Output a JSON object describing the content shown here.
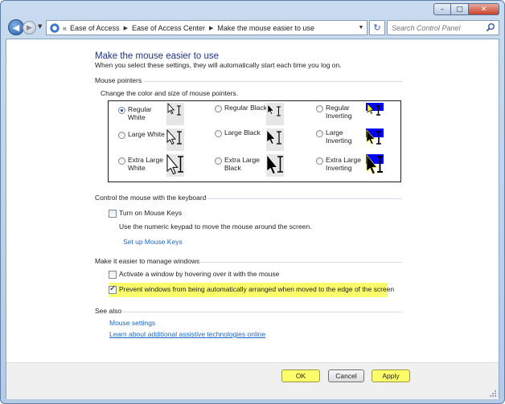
{
  "window": {
    "minimize_glyph": "–",
    "maximize_glyph": "□",
    "close_glyph": "✕"
  },
  "nav": {
    "back_glyph": "◀",
    "forward_glyph": "▶",
    "overflow": "«",
    "breadcrumbs": [
      "Ease of Access",
      "Ease of Access Center",
      "Make the mouse easier to use"
    ],
    "search_placeholder": "Search Control Panel"
  },
  "page": {
    "title": "Make the mouse easier to use",
    "subtitle": "When you select these settings, they will automatically start each time you log on."
  },
  "mouse_pointers": {
    "heading": "Mouse pointers",
    "instruction": "Change the color and size of mouse pointers.",
    "options": [
      {
        "label": "Regular White",
        "selected": true
      },
      {
        "label": "Regular Black",
        "selected": false
      },
      {
        "label": "Regular Inverting",
        "selected": false
      },
      {
        "label": "Large White",
        "selected": false
      },
      {
        "label": "Large Black",
        "selected": false
      },
      {
        "label": "Large Inverting",
        "selected": false
      },
      {
        "label": "Extra Large White",
        "selected": false
      },
      {
        "label": "Extra Large Black",
        "selected": false
      },
      {
        "label": "Extra Large Inverting",
        "selected": false
      }
    ]
  },
  "keyboard": {
    "heading": "Control the mouse with the keyboard",
    "mouse_keys_label": "Turn on Mouse Keys",
    "mouse_keys_checked": false,
    "mouse_keys_desc": "Use the numeric keypad to move the mouse around the screen.",
    "setup_link": "Set up Mouse Keys"
  },
  "windows": {
    "heading": "Make it easier to manage windows",
    "hover_label": "Activate a window by hovering over it with the mouse",
    "hover_checked": false,
    "snap_label": "Prevent windows from being automatically arranged when moved to the edge of the screen",
    "snap_checked": true
  },
  "see_also": {
    "heading": "See also",
    "links": [
      "Mouse settings",
      "Learn about additional assistive technologies online"
    ]
  },
  "buttons": {
    "ok": "OK",
    "cancel": "Cancel",
    "apply": "Apply"
  },
  "colors": {
    "title": "#1e3287",
    "link": "#1a66c8",
    "highlight": "#fbfd6a",
    "inverting_blue": "#0000ff"
  }
}
